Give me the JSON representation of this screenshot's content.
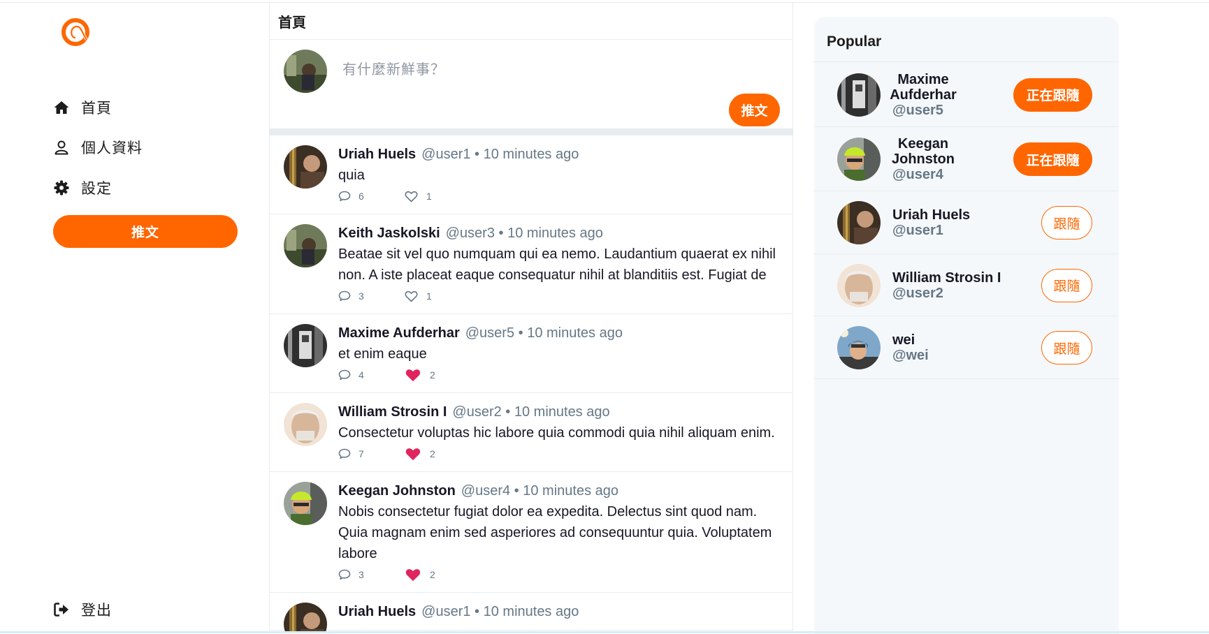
{
  "sidebar": {
    "nav": [
      {
        "label": "首頁",
        "icon": "home-icon"
      },
      {
        "label": "個人資料",
        "icon": "user-icon"
      },
      {
        "label": "設定",
        "icon": "gear-icon"
      }
    ],
    "tweet_button": "推文",
    "logout": {
      "label": "登出",
      "icon": "sign-out-icon"
    }
  },
  "main": {
    "title": "首頁",
    "composer": {
      "placeholder": "有什麼新鮮事？",
      "button": "推文"
    },
    "tweets": [
      {
        "name": "Uriah Huels",
        "meta": "@user1 • 10 minutes ago",
        "body": "quia",
        "replies": "6",
        "likes": "1",
        "liked": false
      },
      {
        "name": "Keith Jaskolski",
        "meta": "@user3 • 10 minutes ago",
        "body": "Beatae sit vel quo numquam qui ea nemo. Laudantium quaerat ex nihil non. A iste placeat eaque consequatur nihil at blanditiis est. Fugiat de",
        "replies": "3",
        "likes": "1",
        "liked": false
      },
      {
        "name": "Maxime Aufderhar",
        "meta": "@user5 • 10 minutes ago",
        "body": "et enim eaque",
        "replies": "4",
        "likes": "2",
        "liked": true
      },
      {
        "name": "William Strosin I",
        "meta": "@user2 • 10 minutes ago",
        "body": "Consectetur voluptas hic labore quia commodi quia nihil aliquam enim.",
        "replies": "7",
        "likes": "2",
        "liked": true
      },
      {
        "name": "Keegan Johnston",
        "meta": "@user4 • 10 minutes ago",
        "body": "Nobis consectetur fugiat dolor ea expedita. Delectus sint quod nam. Quia magnam enim sed asperiores ad consequuntur quia. Voluptatem labore",
        "replies": "3",
        "likes": "2",
        "liked": true
      },
      {
        "name": "Uriah Huels",
        "meta": "@user1 • 10 minutes ago",
        "body": "",
        "replies": "",
        "likes": "",
        "liked": false
      }
    ]
  },
  "popular": {
    "title": "Popular",
    "users": [
      {
        "name": "Maxime Aufderhar",
        "handle": "@user5",
        "button": "正在跟隨",
        "following": true
      },
      {
        "name": "Keegan Johnston",
        "handle": "@user4",
        "button": "正在跟隨",
        "following": true
      },
      {
        "name": "Uriah Huels",
        "handle": "@user1",
        "button": "跟隨",
        "following": false
      },
      {
        "name": "William Strosin I",
        "handle": "@user2",
        "button": "跟隨",
        "following": false
      },
      {
        "name": "wei",
        "handle": "@wei",
        "button": "跟隨",
        "following": false
      }
    ]
  },
  "colors": {
    "accent": "#ff6600",
    "like": "#e0245e",
    "muted": "#657786",
    "border": "#e6ecf0"
  }
}
